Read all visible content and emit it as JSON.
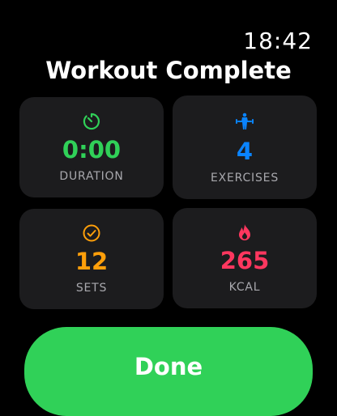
{
  "status": {
    "time": "18:42"
  },
  "title": "Workout Complete",
  "stats": {
    "duration": {
      "value": "0:00",
      "label": "DURATION",
      "color": "#30d158",
      "icon": "timer-icon"
    },
    "exercises": {
      "value": "4",
      "label": "EXERCISES",
      "color": "#0a84ff",
      "icon": "weightlifter-icon"
    },
    "sets": {
      "value": "12",
      "label": "SETS",
      "color": "#ff9f0a",
      "icon": "checkmark-circle-icon"
    },
    "kcal": {
      "value": "265",
      "label": "KCAL",
      "color": "#ff375f",
      "icon": "flame-icon"
    }
  },
  "actions": {
    "done_label": "Done",
    "done_color": "#30d158"
  }
}
